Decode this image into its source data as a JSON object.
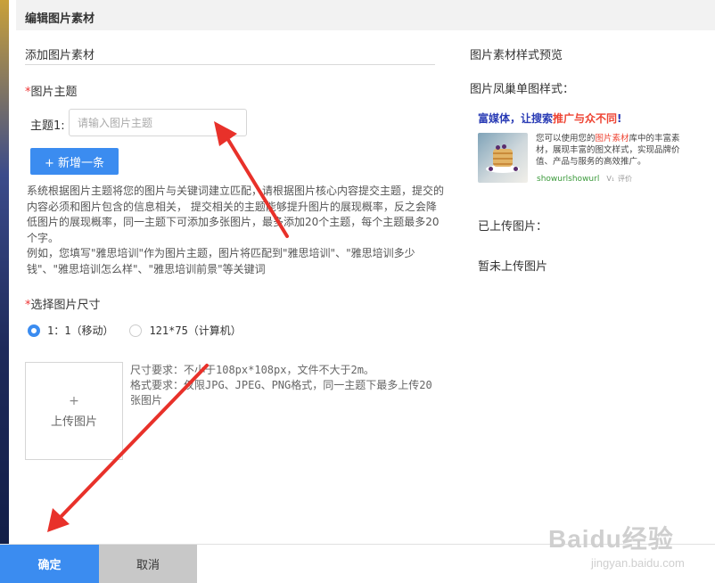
{
  "header": {
    "title": "编辑图片素材"
  },
  "section": {
    "title": "添加图片素材"
  },
  "topic": {
    "required_mark": "*",
    "label": "图片主题",
    "input_label": "主题1:",
    "input_placeholder": "请输入图片主题",
    "input_value": "",
    "add_button": "+ 新增一条"
  },
  "description": {
    "line1": "系统根据图片主题将您的图片与关键词建立匹配，请根据图片核心内容提交主题，提交的内容必须和图片包含的信息相关， 提交相关的主题能够提升图片的展现概率，反之会降低图片的展现概率，同一主题下可添加多张图片，最多添加20个主题，每个主题最多20个字。",
    "line2": "例如，您填写\"雅思培训\"作为图片主题，图片将匹配到\"雅思培训\"、\"雅思培训多少钱\"、\"雅思培训怎么样\"、\"雅思培训前景\"等关键词"
  },
  "size": {
    "required_mark": "*",
    "label": "选择图片尺寸",
    "options": [
      {
        "label": "1：1（移动）",
        "checked": true
      },
      {
        "label": "121*75（计算机）",
        "checked": false
      }
    ]
  },
  "upload": {
    "plus": "+",
    "label": "上传图片",
    "requirement1": "尺寸要求：不小于108px*108px，文件不大于2m。",
    "requirement2": "格式要求：仅限JPG、JPEG、PNG格式，同一主题下最多上传20张图片"
  },
  "preview": {
    "title": "图片素材样式预览",
    "style_label": "图片凤巢单图样式：",
    "ad": {
      "headline_part1": "富媒体，让搜索",
      "headline_red": "推广与众不同",
      "headline_part2": "!",
      "body_part1": "您可以使用您的",
      "body_red": "图片素材",
      "body_part2": "库中的丰富素材，展现丰富的图文样式，实现品牌价值、产品与服务的高效推广。",
      "url": "showurlshowurl",
      "vtag": "V₁",
      "rating": "评价"
    },
    "uploaded_label": "已上传图片：",
    "none_text": "暂未上传图片"
  },
  "footer": {
    "confirm": "确定",
    "cancel": "取消"
  },
  "watermark": {
    "brand": "Baidu经验",
    "url": "jingyan.baidu.com"
  },
  "colors": {
    "accent": "#3b8cf0",
    "arrow": "#e8312a",
    "ad_blue": "#2a3cb5",
    "ad_red": "#e43",
    "ad_green": "#3b9a3b"
  }
}
